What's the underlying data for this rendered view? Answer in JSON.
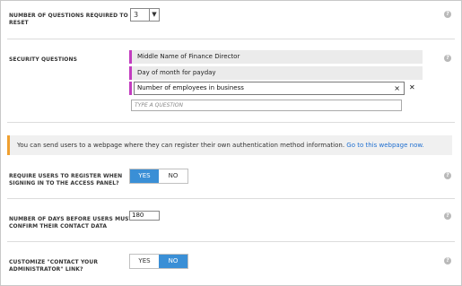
{
  "num_questions": {
    "label_line1": "NUMBER OF QUESTIONS REQUIRED TO",
    "label_line2": "RESET",
    "value": "3",
    "arrow": "▼"
  },
  "security_questions": {
    "label": "SECURITY QUESTIONS",
    "questions": [
      "Middle Name of Finance Director",
      "Day of month for payday"
    ],
    "editing_value": "Number of employees in business",
    "clear_glyph": "×",
    "remove_glyph": "✕",
    "add_placeholder": "TYPE A QUESTION"
  },
  "banner": {
    "text": "You can send users to a webpage where they can register their own authentication method information.",
    "link": "Go to this webpage now."
  },
  "require_register": {
    "label_line1": "REQUIRE USERS TO REGISTER WHEN",
    "label_line2": "SIGNING IN TO THE ACCESS PANEL?",
    "yes": "YES",
    "no": "NO",
    "selected": "YES"
  },
  "days_confirm": {
    "label_line1": "NUMBER OF DAYS BEFORE USERS MUST",
    "label_line2": "CONFIRM THEIR CONTACT DATA",
    "value": "180"
  },
  "customize_link": {
    "label_line1": "CUSTOMIZE \"CONTACT YOUR",
    "label_line2": "ADMINISTRATOR\" LINK?",
    "yes": "YES",
    "no": "NO",
    "selected": "NO"
  },
  "help_glyph": "?",
  "colors": {
    "accent": "#3a8fd6",
    "question_bar": "#c23dbf",
    "banner_bar": "#f0a030",
    "link": "#1f6fd0"
  }
}
